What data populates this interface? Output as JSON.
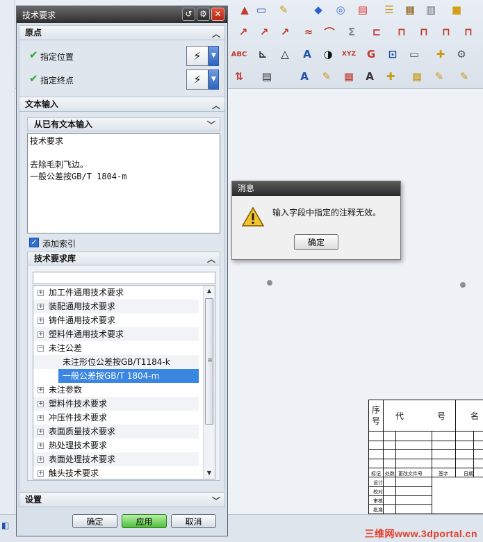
{
  "dialog": {
    "title": "技术要求",
    "sections": {
      "origin": {
        "header": "原点",
        "rows": [
          {
            "label": "指定位置"
          },
          {
            "label": "指定终点"
          }
        ]
      },
      "text_input": {
        "header": "文本输入",
        "sub_header": "从已有文本输入",
        "text": "技术要求\n\n去除毛刺飞边。\n一般公差按GB/T 1804-m",
        "add_index": {
          "label": "添加索引",
          "checked": true
        }
      },
      "library": {
        "header": "技术要求库",
        "items": [
          {
            "label": "加工件通用技术要求",
            "level": 0,
            "expander": "+"
          },
          {
            "label": "装配通用技术要求",
            "level": 0,
            "expander": "+"
          },
          {
            "label": "铸件通用技术要求",
            "level": 0,
            "expander": "+"
          },
          {
            "label": "塑料件通用技术要求",
            "level": 0,
            "expander": "+"
          },
          {
            "label": "未注公差",
            "level": 0,
            "expander": "−"
          },
          {
            "label": "未注形位公差按GB/T1184-k",
            "level": 1,
            "expander": ""
          },
          {
            "label": "一般公差按GB/T 1804-m",
            "level": 1,
            "expander": "",
            "selected": true
          },
          {
            "label": "未注参数",
            "level": 0,
            "expander": "+"
          },
          {
            "label": "塑料件技术要求",
            "level": 0,
            "expander": "+"
          },
          {
            "label": "冲压件技术要求",
            "level": 0,
            "expander": "+"
          },
          {
            "label": "表面质量技术要求",
            "level": 0,
            "expander": "+"
          },
          {
            "label": "热处理技术要求",
            "level": 0,
            "expander": "+"
          },
          {
            "label": "表面处理技术要求",
            "level": 0,
            "expander": "+"
          },
          {
            "label": "触头技术要求",
            "level": 0,
            "expander": "+"
          }
        ]
      },
      "settings": {
        "header": "设置"
      }
    },
    "buttons": {
      "ok": "确定",
      "apply": "应用",
      "cancel": "取消"
    }
  },
  "message": {
    "title": "消息",
    "text": "输入字段中指定的注释无效。",
    "ok": "确定"
  },
  "title_block": {
    "col_index": "序号",
    "col_code": "代",
    "col_code2": "号",
    "col_name": "名",
    "mini_labels": [
      "标记",
      "处数",
      "更改文件号",
      "签字",
      "日期"
    ],
    "side_labels": [
      "设计",
      "校对",
      "审核",
      "批准"
    ]
  },
  "watermark": "三维网www.3dportal.cn",
  "colors": {
    "accent": "#3a86e0",
    "apply_green": "#4fbf3c",
    "close_red": "#d2402c",
    "title_dark": "#2e2e2e"
  }
}
